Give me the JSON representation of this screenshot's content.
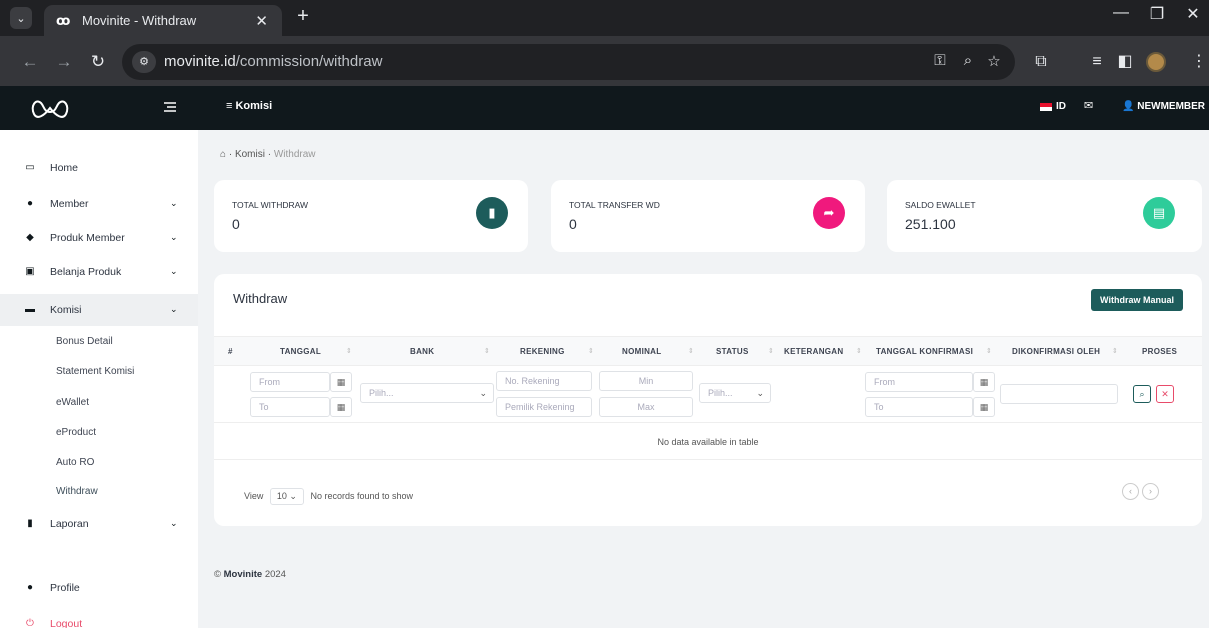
{
  "browser": {
    "tab_title": "Movinite - Withdraw",
    "url_host": "movinite.id",
    "url_path": "/commission/withdraw"
  },
  "topbar": {
    "menu_label": "Komisi",
    "language": "ID",
    "username": "NEWMEMBER"
  },
  "sidebar": {
    "items": [
      {
        "label": "Home",
        "icon": "monitor-icon"
      },
      {
        "label": "Member",
        "icon": "user-icon"
      },
      {
        "label": "Produk Member",
        "icon": "tag-icon"
      },
      {
        "label": "Belanja Produk",
        "icon": "archive-icon"
      },
      {
        "label": "Komisi",
        "icon": "card-icon"
      },
      {
        "label": "Laporan",
        "icon": "book-icon"
      },
      {
        "label": "Profile",
        "icon": "user-icon"
      },
      {
        "label": "Logout",
        "icon": "power-icon"
      }
    ],
    "komisi_sub": [
      "Bonus Detail",
      "Statement Komisi",
      "eWallet",
      "eProduct",
      "Auto RO",
      "Withdraw"
    ]
  },
  "breadcrumb": {
    "parent": "Komisi",
    "current": "Withdraw"
  },
  "cards": [
    {
      "label": "TOTAL WITHDRAW",
      "value": "0",
      "color": "#1d5c5b"
    },
    {
      "label": "TOTAL TRANSFER WD",
      "value": "0",
      "color": "#f0197d"
    },
    {
      "label": "SALDO EWALLET",
      "value": "251.100",
      "color": "#2ecc9a"
    }
  ],
  "panel": {
    "title": "Withdraw",
    "button": "Withdraw Manual",
    "columns": [
      "#",
      "TANGGAL",
      "BANK",
      "REKENING",
      "NOMINAL",
      "STATUS",
      "KETERANGAN",
      "TANGGAL KONFIRMASI",
      "DIKONFIRMASI OLEH",
      "PROSES"
    ],
    "filters": {
      "from": "From",
      "to": "To",
      "select": "Pilih...",
      "rekening": "No. Rekening",
      "pemilik": "Pemilik Rekening",
      "min": "Min",
      "max": "Max"
    },
    "empty": "No data available in table",
    "view_label": "View",
    "page_size": "10",
    "records": "No records found to show"
  },
  "footer": {
    "brand": "Movinite",
    "year": "2024"
  }
}
